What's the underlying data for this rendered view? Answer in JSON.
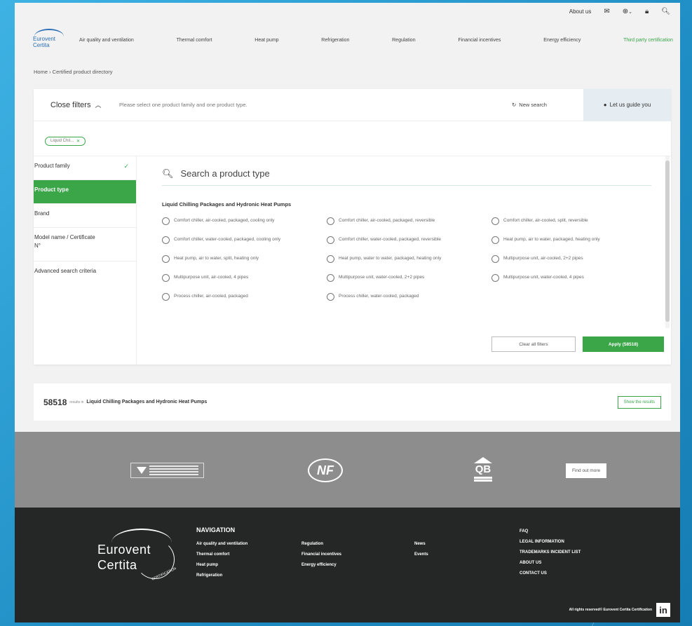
{
  "topbar": {
    "about": "About us",
    "mail_icon": "mail-icon",
    "globe_icon": "globe-icon",
    "globe_chevron": "⌄",
    "lock_icon": "lock-icon",
    "search_icon": "search-icon"
  },
  "logo": {
    "line1": "Eurovent",
    "line2": "Certita"
  },
  "nav": [
    "Air quality and ventilation",
    "Thermal comfort",
    "Heat pump",
    "Refrigeration",
    "Regulation",
    "Financial incentives",
    "Energy efficiency",
    "Third party certification"
  ],
  "breadcrumb": "Home › Certified product directory",
  "filters": {
    "close_label": "Close filters",
    "prompt": "Please select one product family and one product type.",
    "new_search": "New search",
    "guide": "Let us guide you",
    "chip": "Liquid Chil...",
    "sidebar": [
      "Product family",
      "Product type",
      "Brand",
      "Model name / Certificate N°",
      "Advanced search criteria"
    ],
    "search_placeholder": "Search a product type",
    "group_title": "Liquid Chilling Packages and Hydronic Heat Pumps",
    "options": [
      "Comfort chiller, air-cooled, packaged, cooling only",
      "Comfort chiller, air-cooled, packaged, reversible",
      "Comfort chiller, air-cooled, split, reversible",
      "Comfort chiller, water-cooled, packaged, cooling only",
      "Comfort chiller, water-cooled, packaged, reversible",
      "Heat pump, air to water, packaged, heating only",
      "Heat pump, air to water, split, heating only",
      "Heat pump, water to water, packaged, heating only",
      "Multipurpose unit, air-cooled, 2+2 pipes",
      "Multipurpose unit, air-cooled, 4 pipes",
      "Multipurpose unit, water-cooled, 2+2 pipes",
      "Multipurpose unit, water-cooled, 4 pipes",
      "Process chiller, air-cooled, packaged",
      "Process chiller, water-cooled, packaged"
    ],
    "clear_label": "Clear all filters",
    "apply_label": "Apply (58518)"
  },
  "results": {
    "count": "58518",
    "results_in": "results in",
    "category": "Liquid Chilling Packages and Hydronic Heat Pumps",
    "show_label": "Show the results"
  },
  "logos": {
    "nf": "NF",
    "qb": "QB",
    "find_out": "Find out more"
  },
  "footer": {
    "logo_line1": "Eurovent",
    "logo_line2": "Certita",
    "logo_sub": "CERTIFICATION",
    "nav_heading": "NAVIGATION",
    "col1": [
      "Air quality and ventilation",
      "Thermal comfort",
      "Heat pump",
      "Refrigeration"
    ],
    "col2": [
      "Regulation",
      "Financial incentives",
      "Energy efficiency"
    ],
    "col3": [
      "News",
      "Events"
    ],
    "col4": [
      "FAQ",
      "LEGAL INFORMATION",
      "TRADEMARKS INCIDENT LIST",
      "ABOUT US",
      "CONTACT US"
    ],
    "copyright": "All rights reserved© Eurovent Certita Certification",
    "linkedin": "in"
  },
  "colors": {
    "accent": "#3aa648",
    "footer_bg": "#252626",
    "logo_band": "#8d8d8d"
  }
}
